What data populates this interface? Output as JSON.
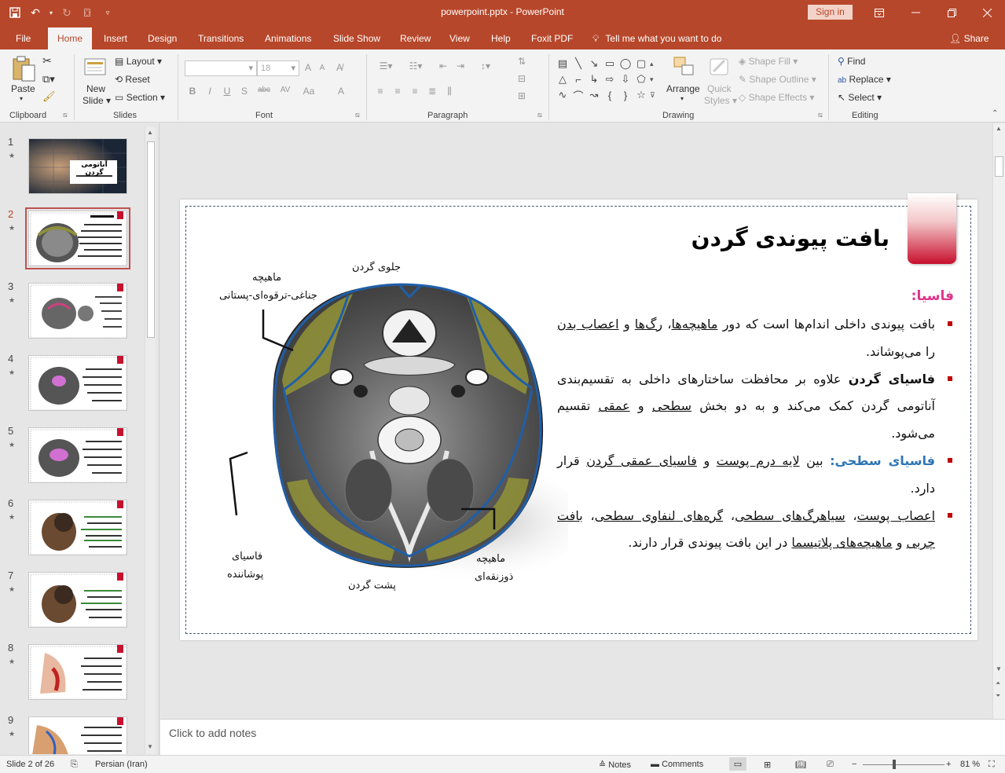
{
  "window": {
    "title": "powerpoint.pptx  -  PowerPoint",
    "signin": "Sign in"
  },
  "tabs": [
    "File",
    "Home",
    "Insert",
    "Design",
    "Transitions",
    "Animations",
    "Slide Show",
    "Review",
    "View",
    "Help",
    "Foxit PDF"
  ],
  "active_tab": "Home",
  "tellme": "Tell me what you want to do",
  "share": "Share",
  "ribbon": {
    "clipboard": {
      "paste": "Paste",
      "label": "Clipboard"
    },
    "slides": {
      "new_slide_1": "New",
      "new_slide_2": "Slide",
      "layout": "Layout",
      "reset": "Reset",
      "section": "Section",
      "label": "Slides"
    },
    "font": {
      "size": "18",
      "label": "Font"
    },
    "paragraph": {
      "label": "Paragraph"
    },
    "drawing": {
      "arrange": "Arrange",
      "quick_styles_1": "Quick",
      "quick_styles_2": "Styles",
      "shape_fill": "Shape Fill",
      "shape_outline": "Shape Outline",
      "shape_effects": "Shape Effects",
      "label": "Drawing"
    },
    "editing": {
      "find": "Find",
      "replace": "Replace",
      "select": "Select",
      "label": "Editing"
    }
  },
  "slides_panel": {
    "numbers": [
      "1",
      "2",
      "3",
      "4",
      "5",
      "6",
      "7",
      "8",
      "9"
    ],
    "active_index": 2,
    "thumb1_title": "آناتومی گردن"
  },
  "slide": {
    "title": "بافت پیوندی گردن",
    "fascia_heading": "فاسیا:",
    "figure_labels": {
      "anterior": "جلوی گردن",
      "scm_1": "ماهیچه",
      "scm_2": "جناغی-ترقوه‌ای-پستانی",
      "investing_1": "فاسیای",
      "investing_2": "پوشاننده",
      "posterior": "پشت گردن",
      "trapezius_1": "ماهیچه",
      "trapezius_2": "ذوزنقه‌ای"
    },
    "bullet1": {
      "t1": "بافت پیوندی داخلی اندام‌ها است که دور ",
      "u1": "ماهیچه‌ها",
      "t2": "، ",
      "u2": "رگ‌ها",
      "t3": " و ",
      "u3": "اعصاب بدن",
      "t4": " را می‌پوشاند."
    },
    "bullet2": {
      "b1": "فاسیای گردن",
      "t1": " علاوه بر محافظت ساختارهای داخلی به تقسیم‌بندی آناتومی گردن کمک می‌کند و به دو بخش ",
      "u1": "سطحی",
      "t2": " و ",
      "u2": "عمقی",
      "t3": " تقسیم می‌شود."
    },
    "bullet3": {
      "blue": "فاسیای سطحی:",
      "t1": " بین ",
      "u1": "لایه درم پوست",
      "t2": " و ",
      "u2": "فاسیای عمقی گردن",
      "t3": " قرار دارد."
    },
    "bullet4": {
      "u1": "اعصاب پوست",
      "t1": "، ",
      "u2": "سیاهرگ‌های سطحی",
      "t2": "، ",
      "u3": "گره‌های لنفاوی سطحی",
      "t3": "، ",
      "u4": "بافت چربی",
      "t4": " و ",
      "u5": "ماهیچه‌های پلاتیسما",
      "t5": " در این بافت پیوندی قرار دارند."
    }
  },
  "notes_placeholder": "Click to add notes",
  "status": {
    "slide_of": "Slide 2 of 26",
    "language": "Persian (Iran)",
    "notes": "Notes",
    "comments": "Comments",
    "zoom": "81 %"
  },
  "colors": {
    "accent": "#b7472a",
    "fascia_blue": "#1f5fa8",
    "muscle_olive": "#8f8f3a",
    "bullet_red": "#c00000",
    "heading_pink": "#e0338a"
  }
}
